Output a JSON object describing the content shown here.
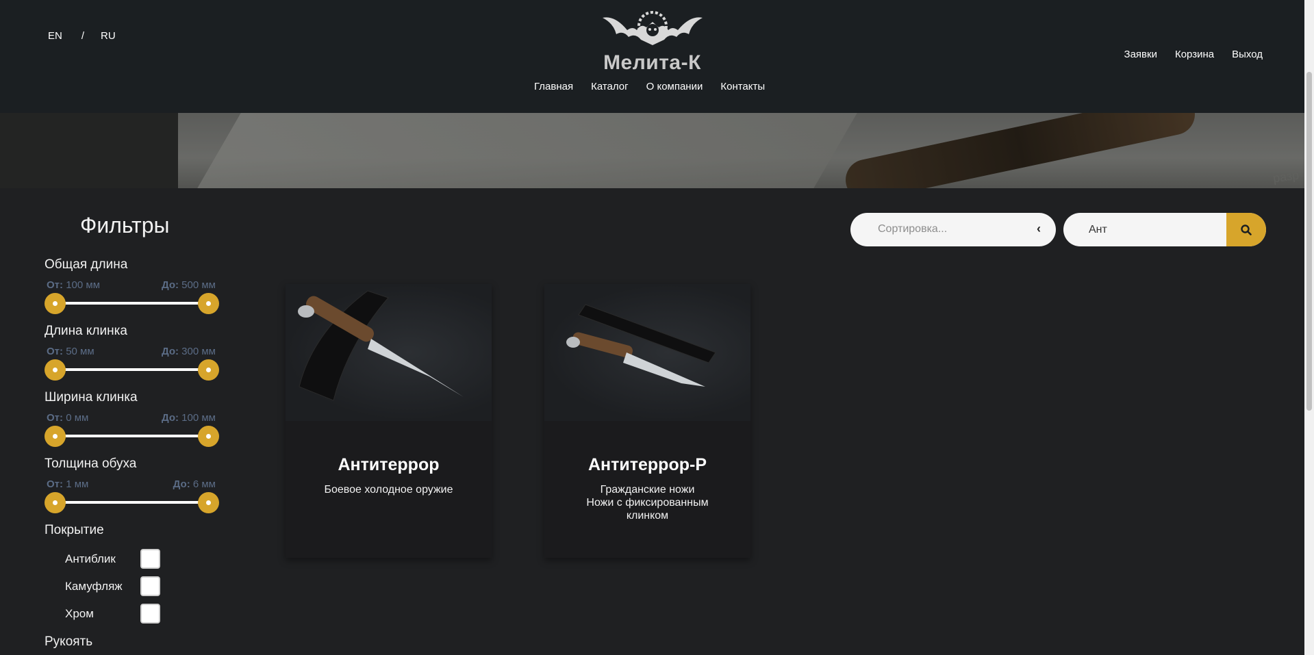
{
  "header": {
    "lang_en": "EN",
    "lang_sep": "/",
    "lang_ru": "RU",
    "logo_text": "Мелита-К",
    "nav": [
      "Главная",
      "Каталог",
      "О компании",
      "Контакты"
    ],
    "user_nav": [
      "Заявки",
      "Корзина",
      "Выход"
    ]
  },
  "filters": {
    "title": "Фильтры",
    "ranges": [
      {
        "label": "Общая длина",
        "from_label": "От:",
        "from": "100 мм",
        "to_label": "До:",
        "to": "500 мм"
      },
      {
        "label": "Длина клинка",
        "from_label": "От:",
        "from": "50 мм",
        "to_label": "До:",
        "to": "300 мм"
      },
      {
        "label": "Ширина клинка",
        "from_label": "От:",
        "from": "0 мм",
        "to_label": "До:",
        "to": "100 мм"
      },
      {
        "label": "Толщина обуха",
        "from_label": "От:",
        "from": "1 мм",
        "to_label": "До:",
        "to": "6 мм"
      }
    ],
    "cover_title": "Покрытие",
    "cover_options": [
      "Антиблик",
      "Камуфляж",
      "Хром"
    ],
    "handle_title": "Рукоять"
  },
  "toolbar": {
    "sort_placeholder": "Сортировка...",
    "search_value": "Ант"
  },
  "products": [
    {
      "name": "Антитеррор",
      "desc_line1": "Боевое холодное оружие",
      "desc_line2": ""
    },
    {
      "name": "Антитеррор-Р",
      "desc_line1": "Гражданские ножи",
      "desc_line2": "Ножи с фиксированным клинком"
    }
  ],
  "colors": {
    "accent": "#d7a52b",
    "header_bg": "#1b1f22",
    "page_bg": "#1f2022"
  }
}
